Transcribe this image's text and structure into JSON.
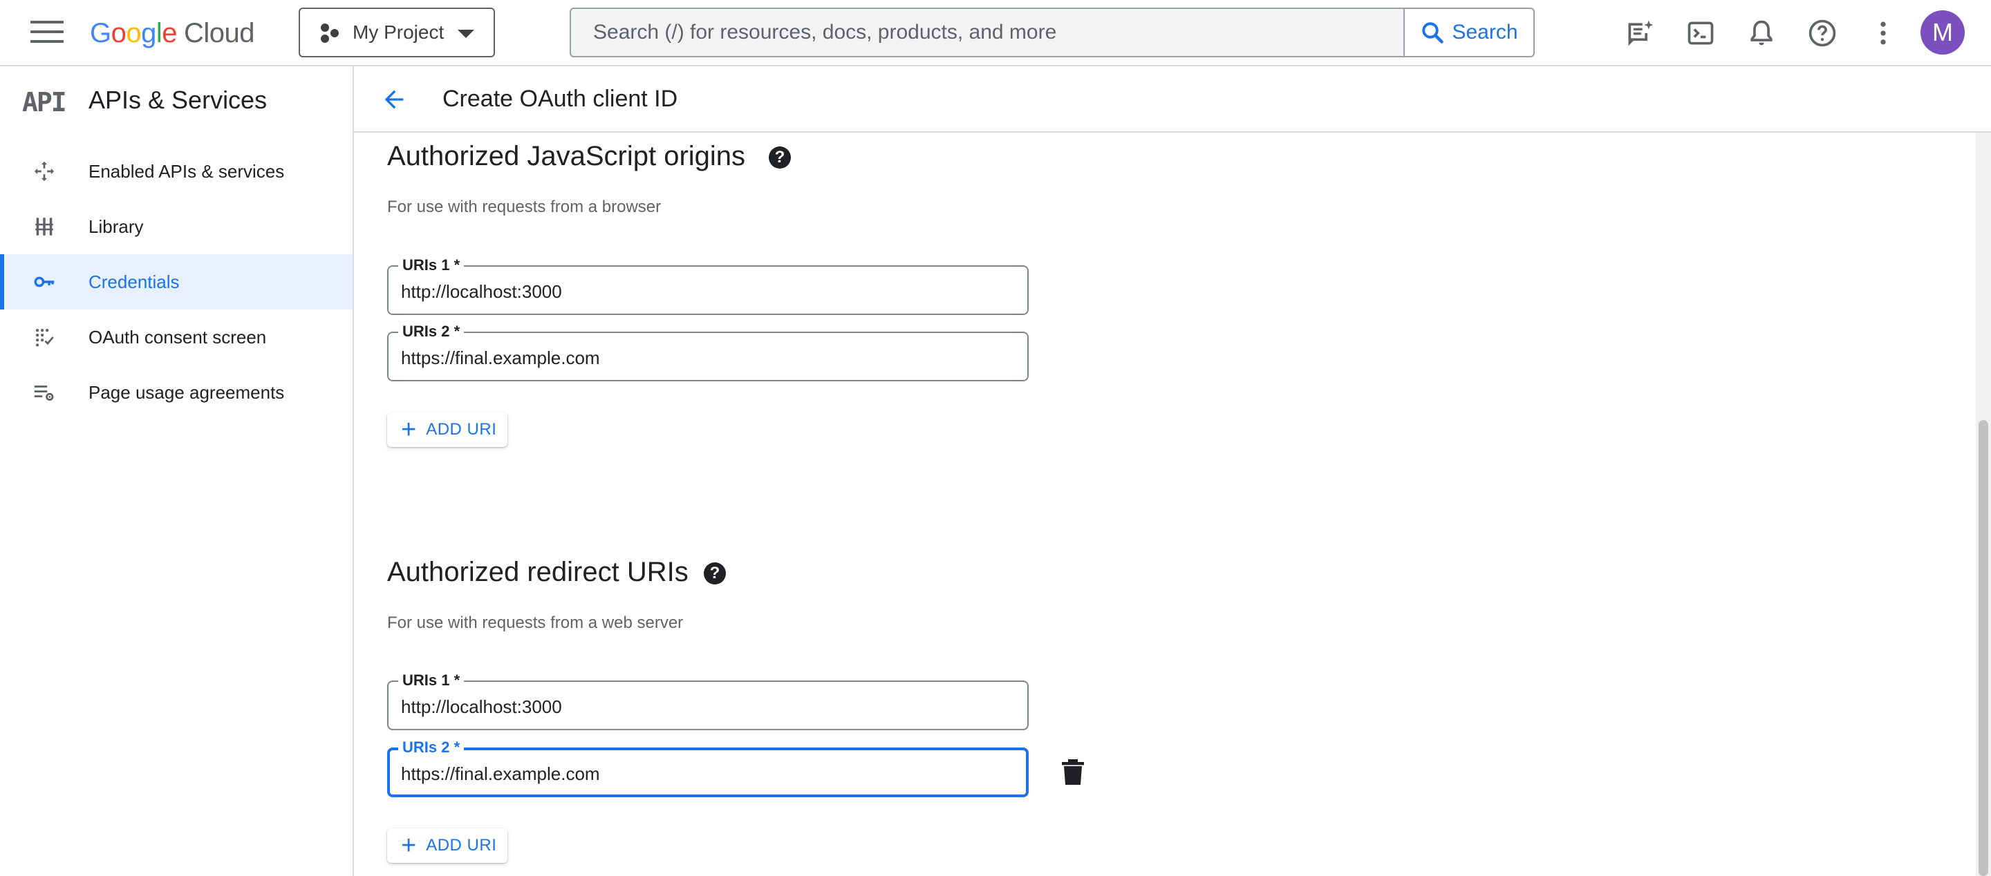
{
  "topbar": {
    "logo": {
      "letters": [
        "G",
        "o",
        "o",
        "g",
        "l",
        "e"
      ],
      "product": "Cloud"
    },
    "project": "My Project",
    "search": {
      "placeholder": "Search (/) for resources, docs, products, and more",
      "button_label": "Search"
    },
    "icons": [
      "gemini-chat-icon",
      "cloud-shell-icon",
      "notifications-icon",
      "help-icon",
      "more-vert-icon"
    ],
    "avatar_initial": "M",
    "avatar_color": "#7b4fbd"
  },
  "sidebar": {
    "logo_text": "API",
    "title": "APIs & Services",
    "items": [
      {
        "label": "Enabled APIs & services",
        "icon": "enabled-apis-icon",
        "active": false
      },
      {
        "label": "Library",
        "icon": "library-icon",
        "active": false
      },
      {
        "label": "Credentials",
        "icon": "key-icon",
        "active": true
      },
      {
        "label": "OAuth consent screen",
        "icon": "oauth-consent-icon",
        "active": false
      },
      {
        "label": "Page usage agreements",
        "icon": "page-settings-icon",
        "active": false
      }
    ]
  },
  "header": {
    "title": "Create OAuth client ID"
  },
  "js_origins": {
    "title": "Authorized JavaScript origins",
    "help": "?",
    "description": "For use with requests from a browser",
    "uris": [
      {
        "label": "URIs 1 *",
        "value": "http://localhost:3000"
      },
      {
        "label": "URIs 2 *",
        "value": "https://final.example.com"
      }
    ],
    "add_label": "ADD URI"
  },
  "redirect_uris": {
    "title": "Authorized redirect URIs",
    "help": "?",
    "description": "For use with requests from a web server",
    "uris": [
      {
        "label": "URIs 1 *",
        "value": "http://localhost:3000"
      },
      {
        "label": "URIs 2 *",
        "value": "https://final.example.com",
        "focused": true
      }
    ],
    "add_label": "ADD URI"
  },
  "colors": {
    "accent": "#1a73e8",
    "active_bg": "#e8f0fe",
    "border": "#dadce0"
  }
}
